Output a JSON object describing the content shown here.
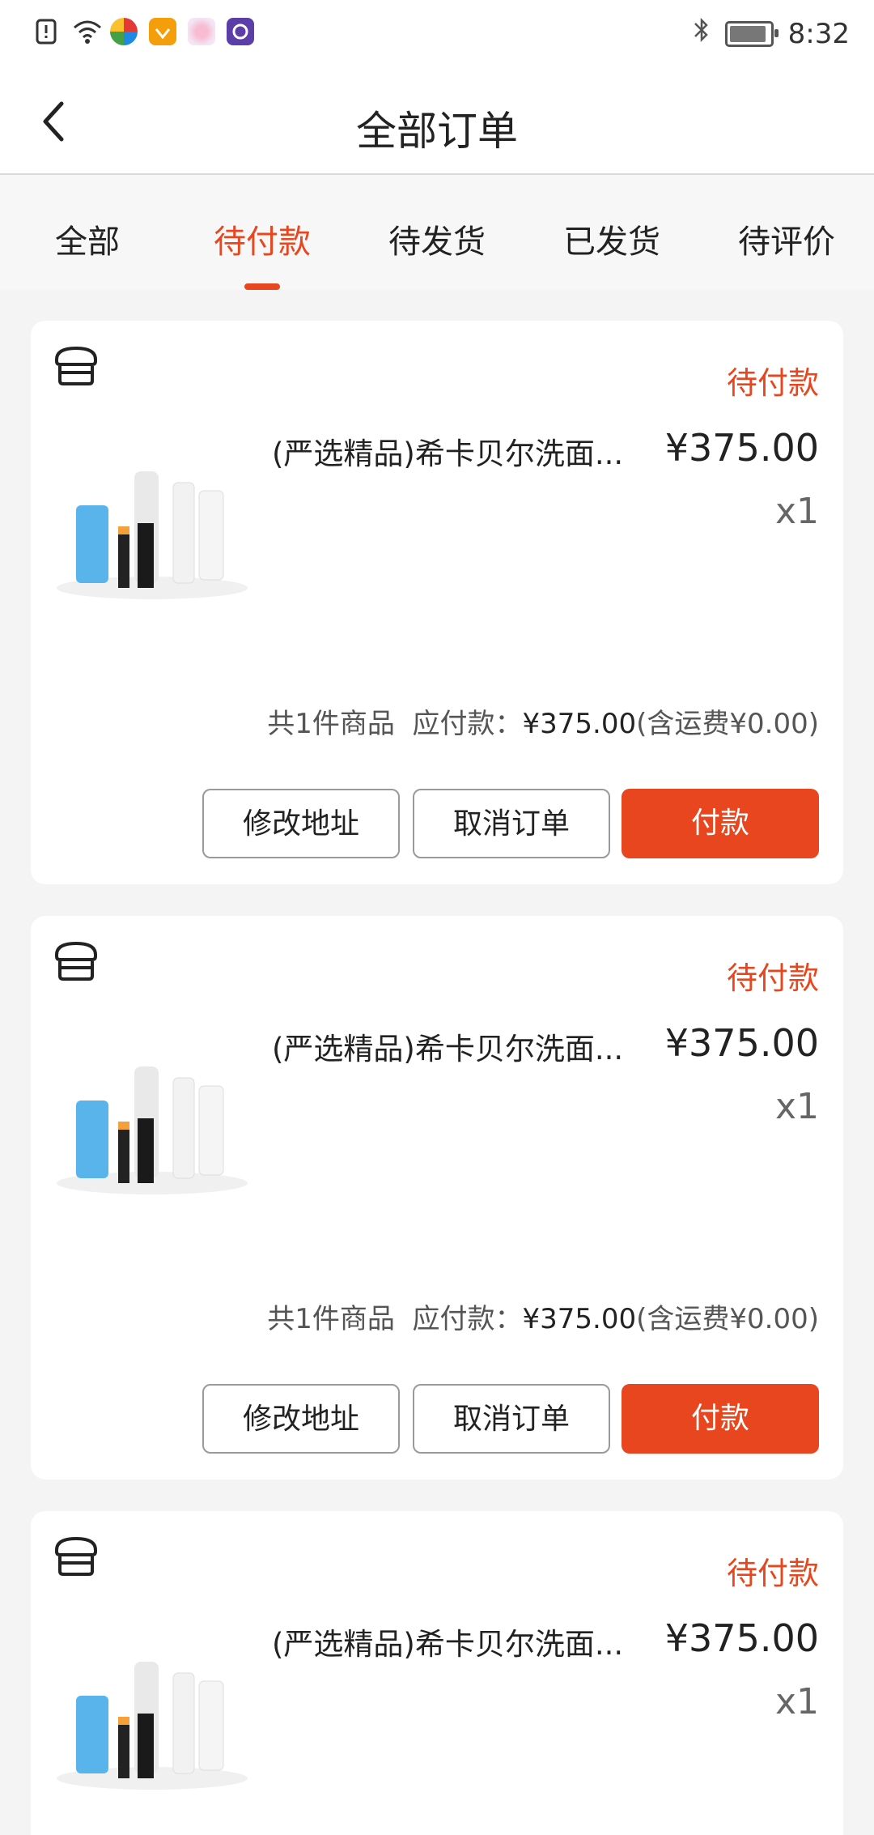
{
  "status_bar": {
    "time": "8:32",
    "icons": [
      "sim-alert-icon",
      "wifi-icon",
      "app-icon-1",
      "app-icon-2",
      "app-icon-3",
      "app-icon-4",
      "bluetooth-icon",
      "battery-icon"
    ]
  },
  "header": {
    "title": "全部订单"
  },
  "tabs": [
    {
      "label": "全部"
    },
    {
      "label": "待付款"
    },
    {
      "label": "待发货"
    },
    {
      "label": "已发货"
    },
    {
      "label": "待评价"
    }
  ],
  "active_tab_index": 1,
  "colors": {
    "accent": "#e8461e",
    "background": "#f4f4f4"
  },
  "orders": [
    {
      "status": "待付款",
      "product_name": "(严选精品)希卡贝尔洗面...",
      "price": "¥375.00",
      "quantity": "x1",
      "summary_count": "共1件商品",
      "summary_label": "应付款：",
      "summary_amount": "¥375.00",
      "summary_shipping": "(含运费¥0.00)",
      "btn_modify": "修改地址",
      "btn_cancel": "取消订单",
      "btn_pay": "付款"
    },
    {
      "status": "待付款",
      "product_name": "(严选精品)希卡贝尔洗面...",
      "price": "¥375.00",
      "quantity": "x1",
      "summary_count": "共1件商品",
      "summary_label": "应付款：",
      "summary_amount": "¥375.00",
      "summary_shipping": "(含运费¥0.00)",
      "btn_modify": "修改地址",
      "btn_cancel": "取消订单",
      "btn_pay": "付款"
    },
    {
      "status": "待付款",
      "product_name": "(严选精品)希卡贝尔洗面...",
      "price": "¥375.00",
      "quantity": "x1"
    }
  ]
}
